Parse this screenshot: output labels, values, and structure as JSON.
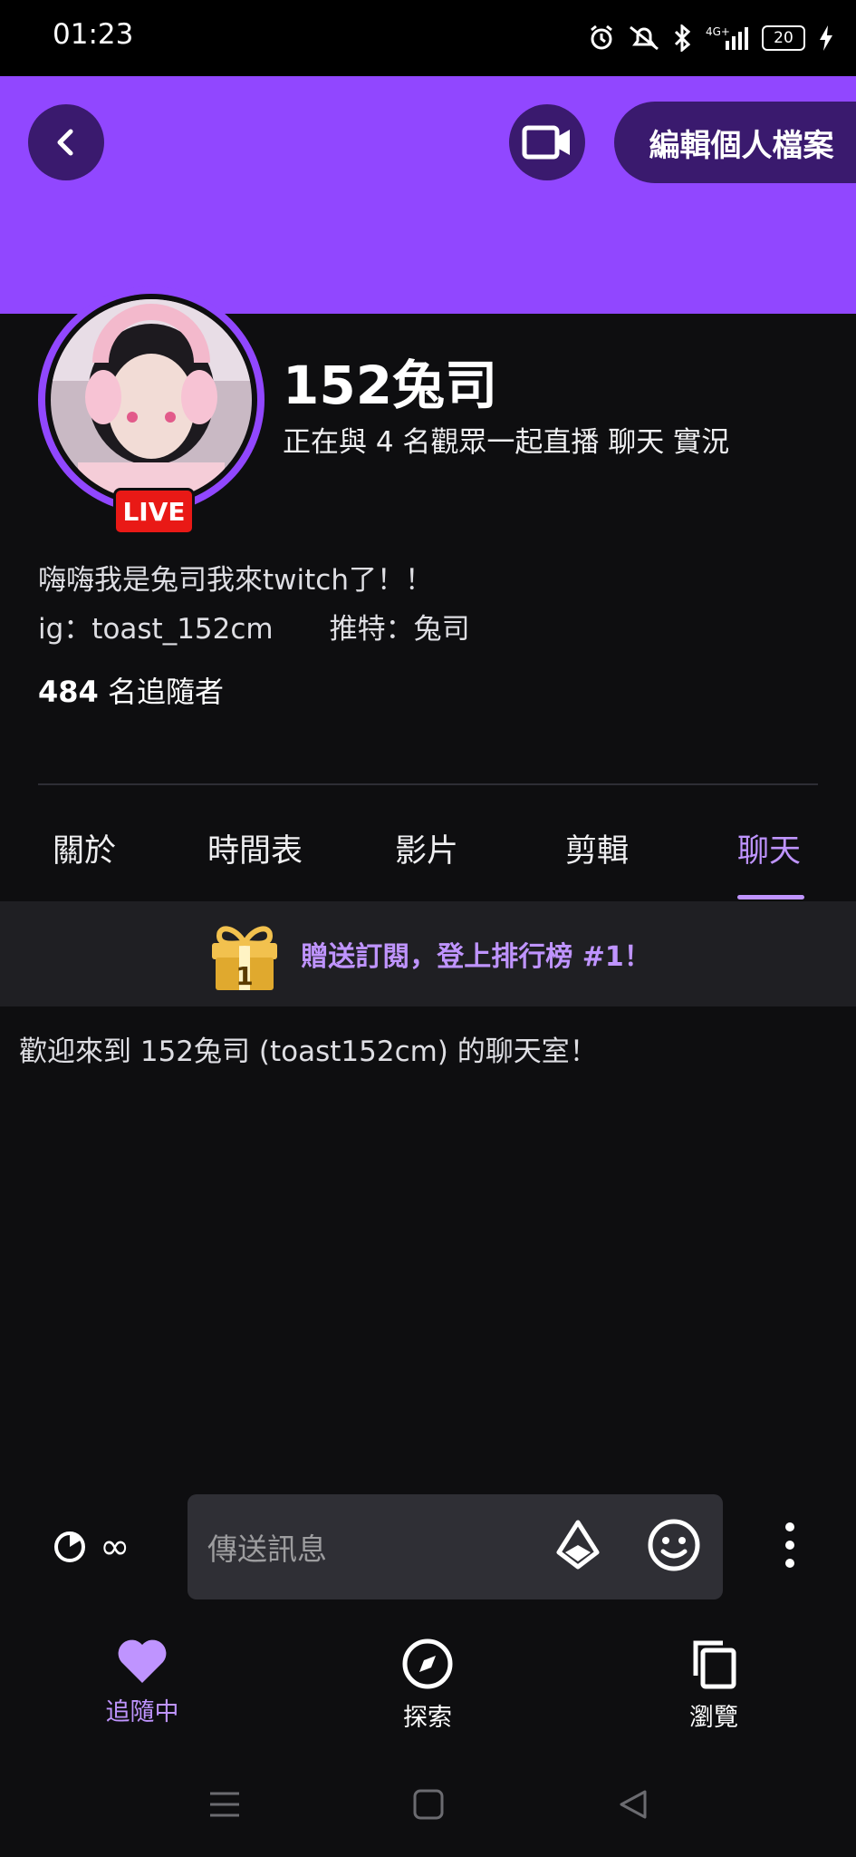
{
  "status_bar": {
    "time": "01:23",
    "battery": "20",
    "network": "4G+"
  },
  "header": {
    "edit_profile_label": "編輯個人檔案"
  },
  "channel": {
    "name": "152兔司",
    "status_line": "正在與 4 名觀眾一起直播 聊天 實況",
    "live_badge": "LIVE",
    "bio_line1": "嗨嗨我是兔司我來twitch了！！",
    "bio_line2": "ig：toast_152cm　　推特：兔司",
    "followers_count": "484",
    "followers_label": " 名追隨者"
  },
  "tabs": [
    {
      "label": "關於"
    },
    {
      "label": "時間表"
    },
    {
      "label": "影片"
    },
    {
      "label": "剪輯"
    },
    {
      "label": "聊天",
      "active": true
    }
  ],
  "gift_banner": {
    "text": "贈送訂閱，登上排行榜 #1！",
    "rank": "1"
  },
  "chat": {
    "welcome_message": "歡迎來到 152兔司 (toast152cm) 的聊天室！",
    "input_placeholder": "傳送訊息",
    "timer_value": "∞"
  },
  "bottom_nav": [
    {
      "label": "追隨中",
      "icon": "heart-icon",
      "active": true
    },
    {
      "label": "探索",
      "icon": "compass-icon"
    },
    {
      "label": "瀏覽",
      "icon": "copy-icon"
    }
  ],
  "colors": {
    "brand": "#9147ff",
    "accent": "#bf94ff",
    "live": "#e91916",
    "background": "#0e0e10"
  }
}
